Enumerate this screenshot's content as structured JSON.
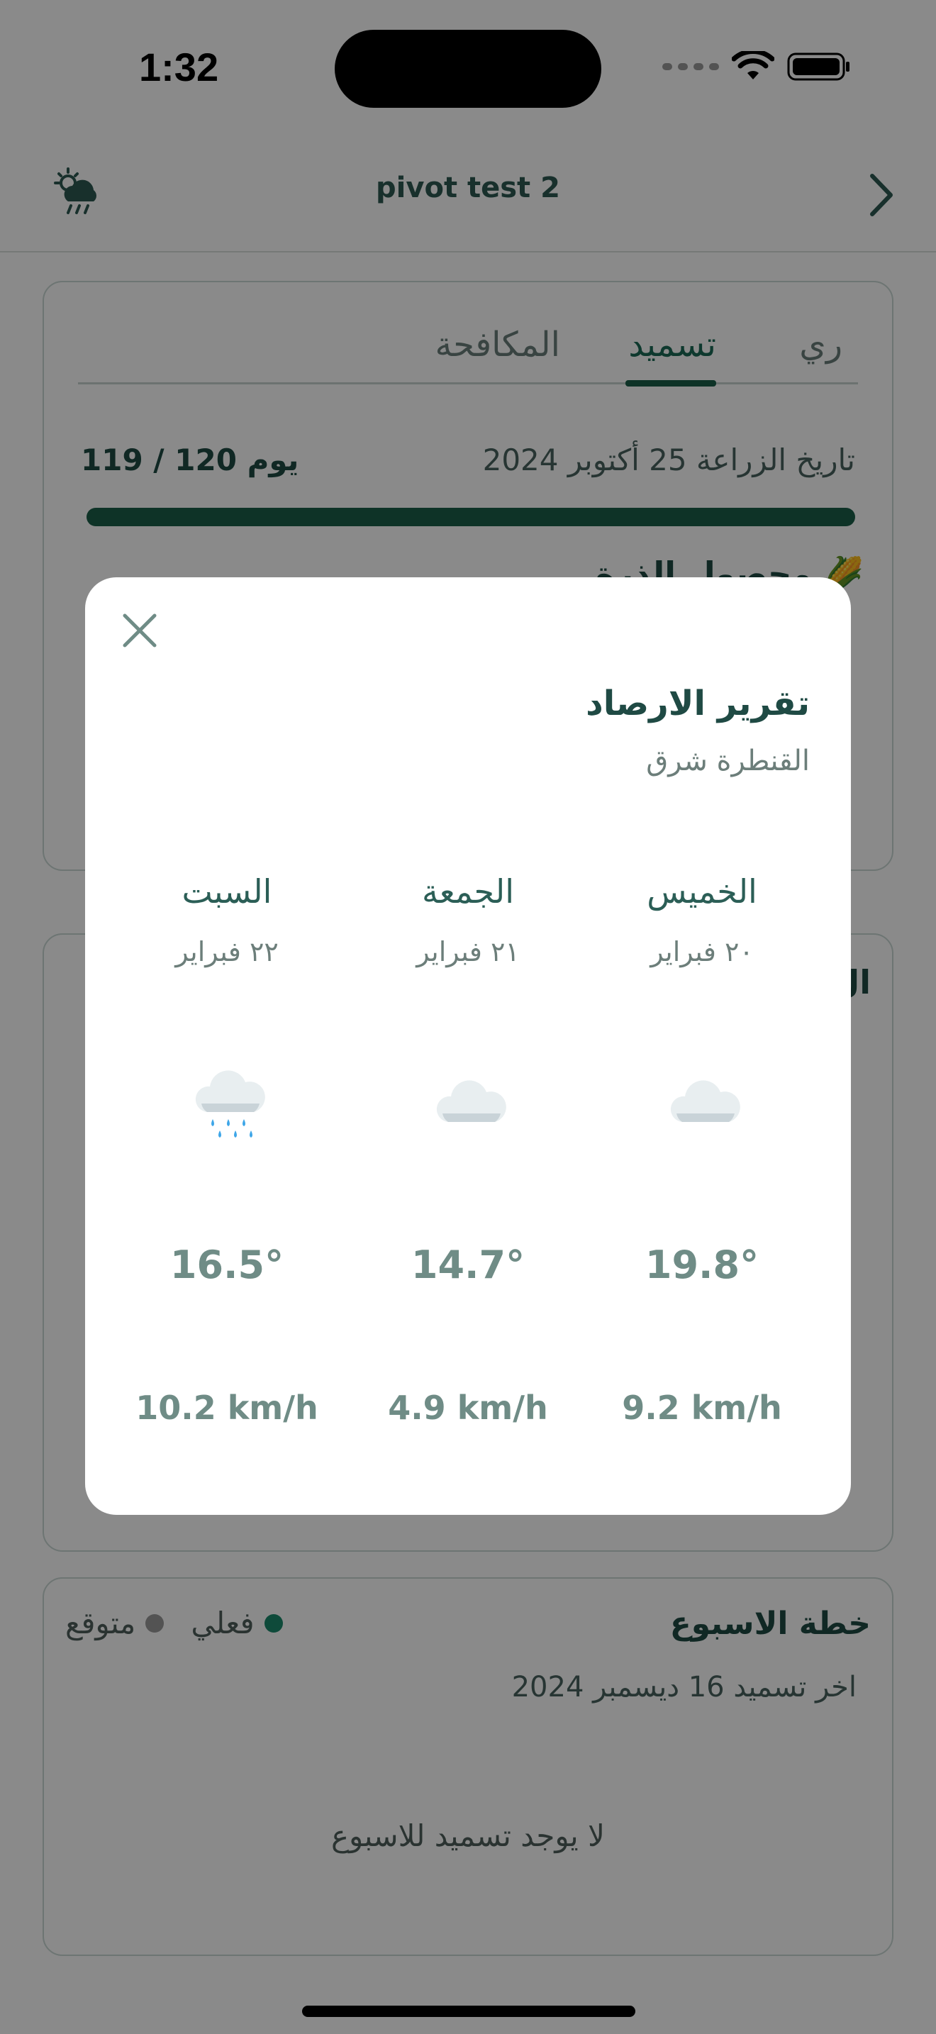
{
  "status_bar": {
    "time": "1:32"
  },
  "header": {
    "title": "pivot test 2",
    "weather_icon": "cloud-rain-sun-icon",
    "back_icon": "chevron-right-icon"
  },
  "tabs": [
    {
      "label": "ري",
      "active": false
    },
    {
      "label": "تسميد",
      "active": true
    },
    {
      "label": "المكافحة",
      "active": false
    }
  ],
  "season": {
    "sowing_date": "تاريخ الزراعة 25 أكتوبر 2024",
    "days": "119 / 120 يوم",
    "progress_fraction": 0.99,
    "crop": "🌽 محصول الذرة"
  },
  "card2": {
    "title": "ال"
  },
  "weekly_plan": {
    "title": "خطة الاسبوع",
    "legend": [
      {
        "label": "فعلي",
        "color": "#1b8a6b"
      },
      {
        "label": "متوقع",
        "color": "#9a9a9a"
      }
    ],
    "last_fertilization": "اخر تسميد 16 ديسمبر 2024",
    "empty_text": "لا يوجد تسميد للاسبوع"
  },
  "modal": {
    "title": "تقرير الارصاد",
    "subtitle": "القنطرة شرق",
    "close_icon": "close-icon",
    "forecast": [
      {
        "day": "الخميس",
        "date": "٢٠ فبراير",
        "icon": "cloud-icon",
        "temp": "19.8°",
        "wind": "9.2 km/h"
      },
      {
        "day": "الجمعة",
        "date": "٢١ فبراير",
        "icon": "cloud-icon",
        "temp": "14.7°",
        "wind": "4.9 km/h"
      },
      {
        "day": "السبت",
        "date": "٢٢ فبراير",
        "icon": "rain-cloud-icon",
        "temp": "16.5°",
        "wind": "10.2 km/h"
      }
    ]
  },
  "colors": {
    "primary": "#1b5e48",
    "text_dark": "#1f4a44",
    "muted": "#6f8c86"
  }
}
